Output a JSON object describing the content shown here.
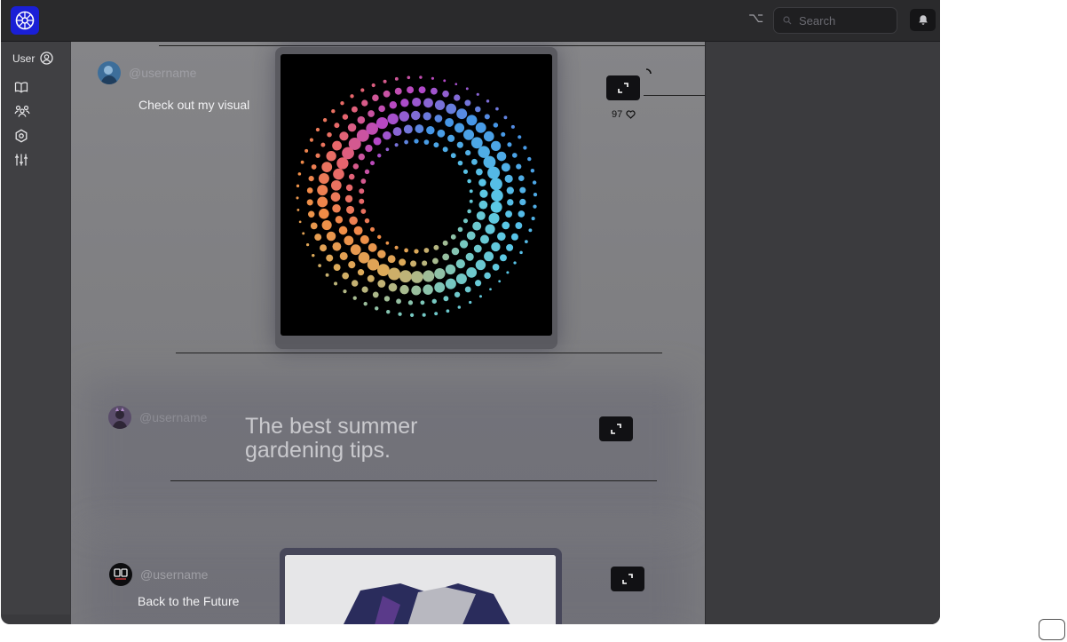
{
  "header": {
    "search_placeholder": "Search"
  },
  "sidebar": {
    "user_label": "User",
    "icons": [
      "book-icon",
      "community-icon",
      "settings-hex-icon",
      "sliders-icon"
    ]
  },
  "posts": [
    {
      "username": "@username",
      "caption": "Check out my visual",
      "likes": "97",
      "media": "dotted-ring-visual"
    },
    {
      "username": "@username",
      "headline": "The best summer gardening tips."
    },
    {
      "username": "@username",
      "caption": "Back to the Future",
      "media": "garment-photo"
    }
  ],
  "colors": {
    "brand": "#1a1fd6",
    "topbar": "#2a2a2c",
    "sidebar": "#404043",
    "feed": "#808083"
  }
}
